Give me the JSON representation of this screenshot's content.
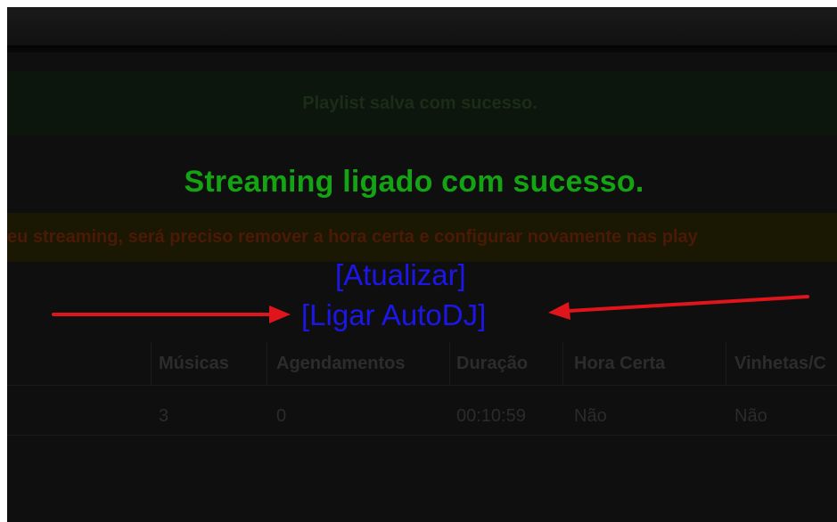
{
  "alerts": {
    "playlist_saved": "Playlist salva com sucesso.",
    "streaming_on": "Streaming ligado com sucesso.",
    "warning": "eu streaming, será preciso remover a hora certa e configurar novamente nas play"
  },
  "links": {
    "refresh": "[Atualizar]",
    "autodj": "[Ligar AutoDJ]"
  },
  "table": {
    "headers": [
      "Músicas",
      "Agendamentos",
      "Duração",
      "Hora Certa",
      "Vinhetas/C"
    ],
    "row": [
      "3",
      "0",
      "00:10:59",
      "Não",
      "Não"
    ]
  },
  "colors": {
    "success_text": "#13a313",
    "link": "#1c17e8",
    "arrow": "#e0141b"
  }
}
